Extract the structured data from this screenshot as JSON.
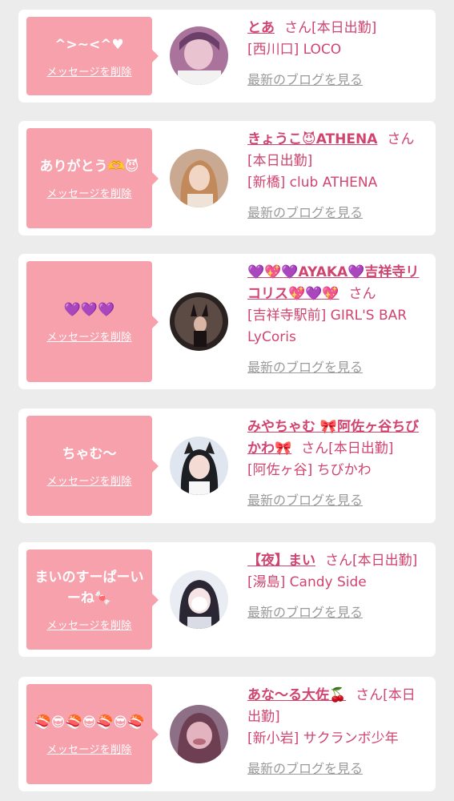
{
  "delete_label": "メッセージを削除",
  "blog_label": "最新のブログを見る",
  "san_label": "さん",
  "colors": {
    "background": "#ececec",
    "card": "#ffffff",
    "bubble": "#f7a1ad",
    "name_link": "#d04470",
    "blog_link": "#9a9a9a"
  },
  "messages": [
    {
      "message": "^>~<^♥",
      "name": "とあ",
      "status": "[本日出勤]",
      "shop": "[西川口] LOCO",
      "avatar_icon": "profile-photo-toa"
    },
    {
      "message": "ありがとう🫶😈",
      "name": "きょうこ😈ATHENA",
      "status": "[本日出勤]",
      "shop": "[新橋] club ATHENA",
      "avatar_icon": "profile-photo-kyoko"
    },
    {
      "message": "💜💜💜",
      "name": "💜💖💜AYAKA💜吉祥寺リコリス💖💜💖",
      "status": "",
      "shop": "[吉祥寺駅前] GIRL'S BAR LyCoris",
      "avatar_icon": "profile-photo-ayaka"
    },
    {
      "message": "ちゃむ〜",
      "name": "みやちゃむ 🎀阿佐ヶ谷ちびかわ🎀",
      "status": "[本日出勤]",
      "shop": "[阿佐ヶ谷] ちびかわ",
      "avatar_icon": "profile-photo-miya"
    },
    {
      "message": "まいのすーぱーいーね🍬",
      "name": "【夜】まい",
      "status": "[本日出勤]",
      "shop": "[湯島] Candy Side",
      "avatar_icon": "profile-photo-mai"
    },
    {
      "message": "🍣😎🍣😎🍣😎🍣",
      "name": "あな〜る大佐🍒",
      "status": "[本日出勤]",
      "shop": "[新小岩] サクランボ少年",
      "avatar_icon": "profile-photo-anal"
    }
  ]
}
